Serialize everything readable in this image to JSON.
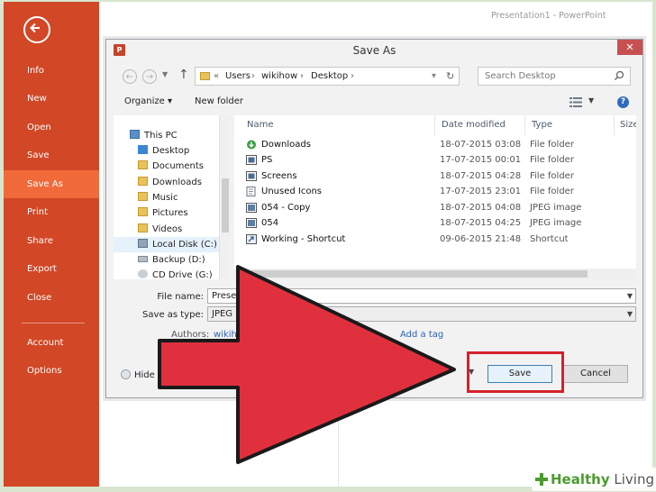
{
  "app": {
    "title": "Presentation1 - PowerPoint"
  },
  "sidebar": {
    "back_icon": "back-arrow-icon",
    "items": [
      {
        "label": "Info"
      },
      {
        "label": "New"
      },
      {
        "label": "Open"
      },
      {
        "label": "Save"
      },
      {
        "label": "Save As",
        "active": true
      },
      {
        "label": "Print"
      },
      {
        "label": "Share"
      },
      {
        "label": "Export"
      },
      {
        "label": "Close"
      },
      {
        "label": "Account"
      },
      {
        "label": "Options"
      }
    ],
    "color": "#d24726",
    "active_color": "#f06a3a"
  },
  "dialog": {
    "title": "Save As",
    "close_label": "✕",
    "address": {
      "overflow": "«",
      "crumbs": [
        "Users",
        "wikihow",
        "Desktop"
      ]
    },
    "search_placeholder": "Search Desktop",
    "toolbar": {
      "organize": "Organize ▾",
      "new_folder": "New folder",
      "help": "?"
    },
    "nav_tree": [
      {
        "label": "This PC",
        "icon": "computer-icon"
      },
      {
        "label": "Desktop",
        "icon": "folder-icon"
      },
      {
        "label": "Documents",
        "icon": "folder-icon"
      },
      {
        "label": "Downloads",
        "icon": "folder-icon"
      },
      {
        "label": "Music",
        "icon": "folder-icon"
      },
      {
        "label": "Pictures",
        "icon": "folder-icon"
      },
      {
        "label": "Videos",
        "icon": "folder-icon"
      },
      {
        "label": "Local Disk (C:)",
        "icon": "drive-icon",
        "selected": true
      },
      {
        "label": "Backup (D:)",
        "icon": "drive-icon"
      },
      {
        "label": "CD Drive (G:)",
        "icon": "disc-icon"
      }
    ],
    "columns": {
      "name": "Name",
      "date": "Date modified",
      "type": "Type",
      "size": "Size"
    },
    "files": [
      {
        "name": "Downloads",
        "date": "18-07-2015 03:08",
        "type": "File folder",
        "icon": "download-folder-icon"
      },
      {
        "name": "PS",
        "date": "17-07-2015 00:01",
        "type": "File folder",
        "icon": "folder-icon"
      },
      {
        "name": "Screens",
        "date": "18-07-2015 04:28",
        "type": "File folder",
        "icon": "folder-icon"
      },
      {
        "name": "Unused Icons",
        "date": "17-07-2015 23:01",
        "type": "File folder",
        "icon": "folder-icon"
      },
      {
        "name": "054 - Copy",
        "date": "18-07-2015 04:08",
        "type": "JPEG image",
        "icon": "image-icon"
      },
      {
        "name": "054",
        "date": "18-07-2015 04:25",
        "type": "JPEG image",
        "icon": "image-icon"
      },
      {
        "name": "Working - Shortcut",
        "date": "09-06-2015 21:48",
        "type": "Shortcut",
        "icon": "shortcut-icon"
      }
    ],
    "form": {
      "file_name_label": "File name:",
      "file_name_value": "Presentati",
      "type_label": "Save as type:",
      "type_value": "JPEG File In",
      "authors_label": "Authors:",
      "authors_value": "wikihow",
      "tags_link": "Add a tag"
    },
    "hide_folders": "Hide",
    "save_label": "Save",
    "cancel_label": "Cancel"
  },
  "annotation": {
    "arrow_color": "#e0303e",
    "highlight_color": "#d5212b"
  },
  "watermark": {
    "healthy": "Healthy",
    "living": "Living"
  }
}
